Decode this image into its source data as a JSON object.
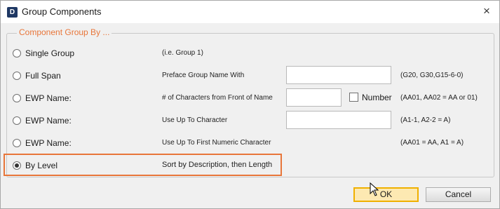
{
  "window": {
    "icon_letter": "D",
    "title": "Group Components",
    "close_glyph": "×"
  },
  "groupbox": {
    "legend": "Component Group By ..."
  },
  "options": [
    {
      "label": "Single Group",
      "description": "(i.e. Group 1)",
      "checked": false
    },
    {
      "label": "Full Span",
      "description": "Preface Group Name With",
      "input_value": "",
      "hint": "(G20, G30,G15-6-0)",
      "checked": false
    },
    {
      "label": "EWP Name:",
      "description": "# of Characters from Front of Name",
      "input_value": "",
      "checkbox_label": "Number",
      "checkbox_checked": false,
      "hint": "(AA01, AA02 = AA or 01)",
      "checked": false
    },
    {
      "label": "EWP Name:",
      "description": "Use Up To Character",
      "input_value": "",
      "hint": "(A1-1, A2-2 = A)",
      "checked": false
    },
    {
      "label": "EWP Name:",
      "description": "Use Up To First Numeric Character",
      "hint": "(AA01 = AA, A1 = A)",
      "checked": false
    },
    {
      "label": "By Level",
      "description": "Sort by Description, then Length",
      "checked": true
    }
  ],
  "buttons": {
    "ok": "OK",
    "cancel": "Cancel"
  },
  "colors": {
    "accent": "#e8763a",
    "ok_border": "#f0b000"
  }
}
